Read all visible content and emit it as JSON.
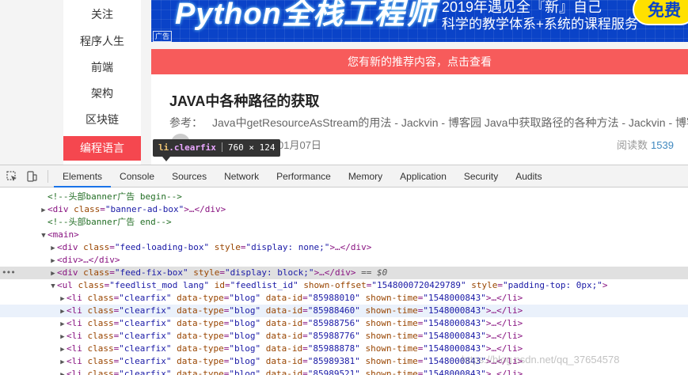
{
  "sidebar": {
    "items": [
      "关注",
      "程序人生",
      "前端",
      "架构",
      "区块链",
      "编程语言"
    ],
    "active_index": 5
  },
  "banner": {
    "main_text": "Python全栈工程师",
    "sub_line1": "2019年遇见全『新』自己",
    "sub_line2": "科学的教学体系+系统的课程服务",
    "cta": "免费",
    "ad_label": "广告"
  },
  "notice": {
    "text": "您有新的推荐内容，点击查看"
  },
  "article": {
    "title": "JAVA中各种路径的获取",
    "summary_label": "参考：",
    "summary_text": "Java中getResourceAsStream的用法 - Jackvin - 博客园 Java中获取路径的各种方法 - Jackvin - 博客",
    "date": "01月07日",
    "reads_label": "阅读数",
    "reads_count": "1539"
  },
  "tooltip": {
    "tag": "li",
    "cls": ".clearfix",
    "size": "760 × 124"
  },
  "devtools": {
    "tabs": [
      "Elements",
      "Console",
      "Sources",
      "Network",
      "Performance",
      "Memory",
      "Application",
      "Security",
      "Audits"
    ],
    "active_tab": "Elements",
    "dom_lines": {
      "l0": "<!--头部banner广告 begin-->",
      "l1_tag": "div",
      "l1_attr": "class",
      "l1_val": "\"banner-ad-box\"",
      "l1_rest": ">…</div>",
      "l2": "<!--头部banner广告 end-->",
      "l3": "<main>",
      "l4_attr1": "class",
      "l4_val1": "\"feed-loading-box\"",
      "l4_attr2": "style",
      "l4_val2": "\"display: none;\"",
      "l4_rest": ">…</div>",
      "l5": "<div>…</div>",
      "l6_attr1": "class",
      "l6_val1": "\"feed-fix-box\"",
      "l6_attr2": "style",
      "l6_val2": "\"display: block;\"",
      "l6_rest": ">…</div>",
      "l6_eq": " == $0",
      "l7_attrs": [
        {
          "a": "class",
          "v": "\"feedlist_mod lang\""
        },
        {
          "a": "id",
          "v": "\"feedlist_id\""
        },
        {
          "a": "shown-offset",
          "v": "\"1548000720429789\""
        },
        {
          "a": "style",
          "v": "\"padding-top: 0px;\""
        }
      ],
      "li_rows": [
        {
          "id": "\"85988010\"",
          "time": "\"1548000843\""
        },
        {
          "id": "\"85988460\"",
          "time": "\"1548000843\""
        },
        {
          "id": "\"85988756\"",
          "time": "\"1548000843\""
        },
        {
          "id": "\"85988776\"",
          "time": "\"1548000843\""
        },
        {
          "id": "\"85988878\"",
          "time": "\"1548000843\""
        },
        {
          "id": "\"85989381\"",
          "time": "\"1548000843\""
        },
        {
          "id": "\"85989521\"",
          "time": "\"1548000843\""
        }
      ],
      "li_class": "\"clearfix\"",
      "li_type": "\"blog\""
    }
  },
  "watermark": "https://blog.csdn.net/qq_37654578"
}
